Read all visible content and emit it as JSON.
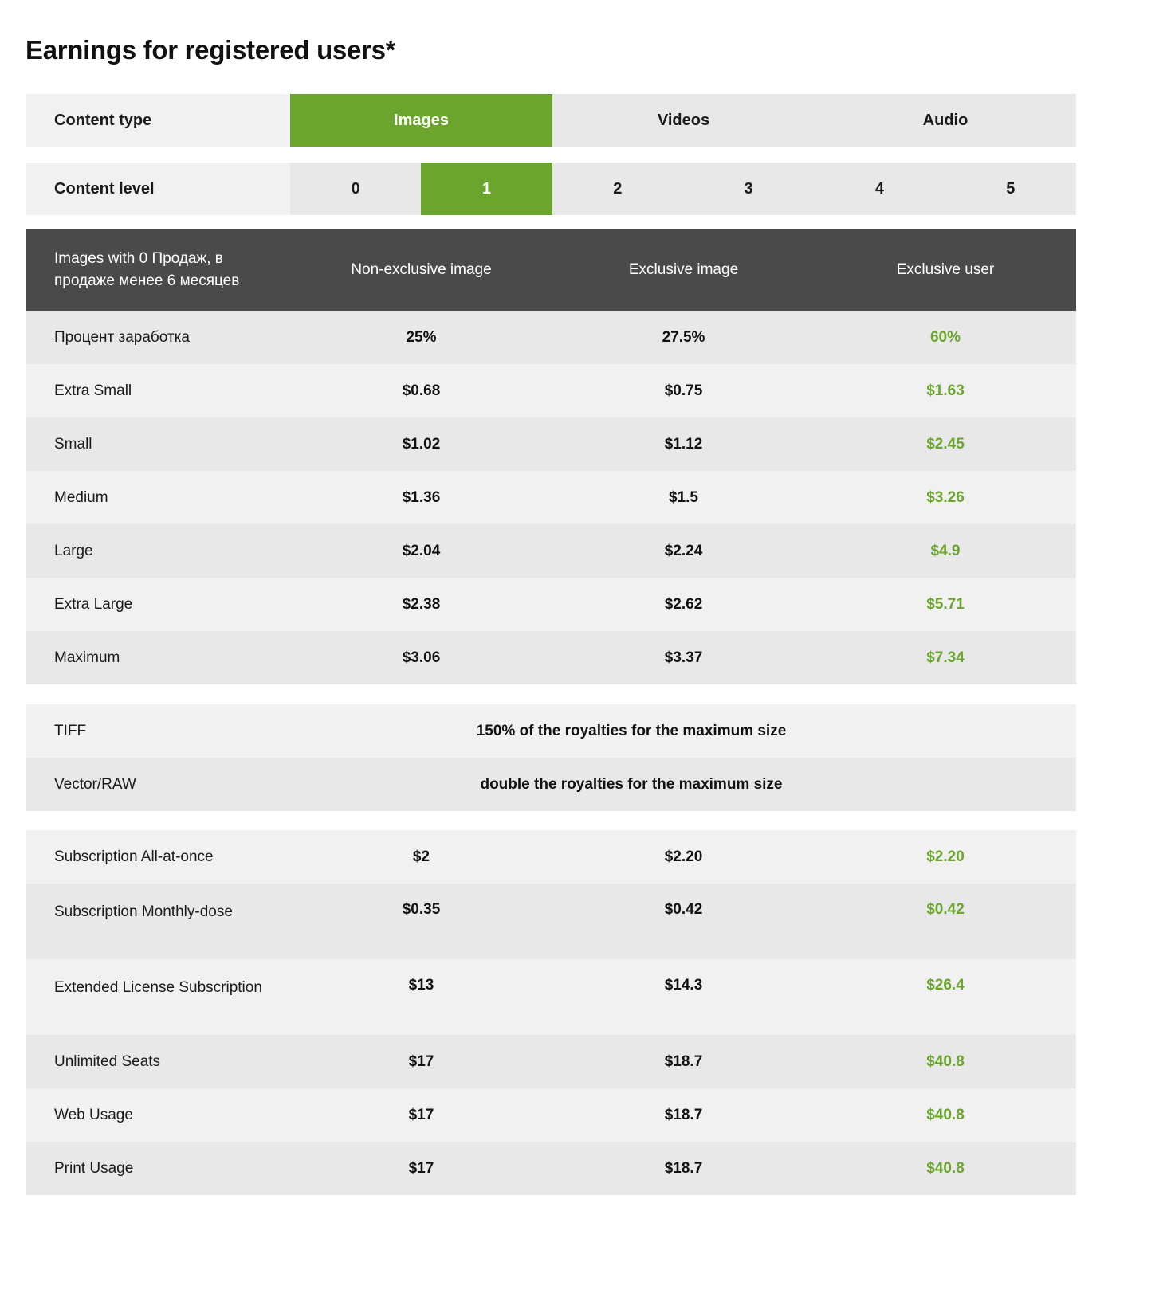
{
  "header": {
    "title": "Earnings for registered users*"
  },
  "accent_colors": {
    "green": "#6ba52e",
    "dark_header": "#4a4a4a",
    "row_alt": "#e8e8e8",
    "row_base": "#f1f1f1"
  },
  "content_type": {
    "label": "Content type",
    "options": [
      {
        "label": "Images",
        "selected": true
      },
      {
        "label": "Videos",
        "selected": false
      },
      {
        "label": "Audio",
        "selected": false
      }
    ]
  },
  "content_level": {
    "label": "Content level",
    "options": [
      {
        "label": "0",
        "selected": false
      },
      {
        "label": "1",
        "selected": true
      },
      {
        "label": "2",
        "selected": false
      },
      {
        "label": "3",
        "selected": false
      },
      {
        "label": "4",
        "selected": false
      },
      {
        "label": "5",
        "selected": false
      }
    ]
  },
  "earnings_table": {
    "columns": [
      "Images with 0 Продаж, в продаже менее 6 месяцев",
      "Non-exclusive image",
      "Exclusive image",
      "Exclusive user"
    ],
    "rows": [
      {
        "label": "Процент заработка",
        "v1": "25%",
        "v2": "27.5%",
        "v3": "60%"
      },
      {
        "label": "Extra Small",
        "v1": "$0.68",
        "v2": "$0.75",
        "v3": "$1.63"
      },
      {
        "label": "Small",
        "v1": "$1.02",
        "v2": "$1.12",
        "v3": "$2.45"
      },
      {
        "label": "Medium",
        "v1": "$1.36",
        "v2": "$1.5",
        "v3": "$3.26"
      },
      {
        "label": "Large",
        "v1": "$2.04",
        "v2": "$2.24",
        "v3": "$4.9"
      },
      {
        "label": "Extra Large",
        "v1": "$2.38",
        "v2": "$2.62",
        "v3": "$5.71"
      },
      {
        "label": "Maximum",
        "v1": "$3.06",
        "v2": "$3.37",
        "v3": "$7.34"
      }
    ]
  },
  "format_table": {
    "rows": [
      {
        "label": "TIFF",
        "value": "150% of the royalties for the maximum size"
      },
      {
        "label": "Vector/RAW",
        "value": "double the royalties for the maximum size"
      }
    ]
  },
  "subscription_table": {
    "rows": [
      {
        "label": "Subscription All-at-once",
        "v1": "$2",
        "v2": "$2.20",
        "v3": "$2.20"
      },
      {
        "label": "Subscription Monthly-dose",
        "v1": "$0.35",
        "v2": "$0.42",
        "v3": "$0.42"
      },
      {
        "label": "Extended License Subscription",
        "v1": "$13",
        "v2": "$14.3",
        "v3": "$26.4"
      },
      {
        "label": "Unlimited Seats",
        "v1": "$17",
        "v2": "$18.7",
        "v3": "$40.8"
      },
      {
        "label": "Web Usage",
        "v1": "$17",
        "v2": "$18.7",
        "v3": "$40.8"
      },
      {
        "label": "Print Usage",
        "v1": "$17",
        "v2": "$18.7",
        "v3": "$40.8"
      }
    ]
  }
}
